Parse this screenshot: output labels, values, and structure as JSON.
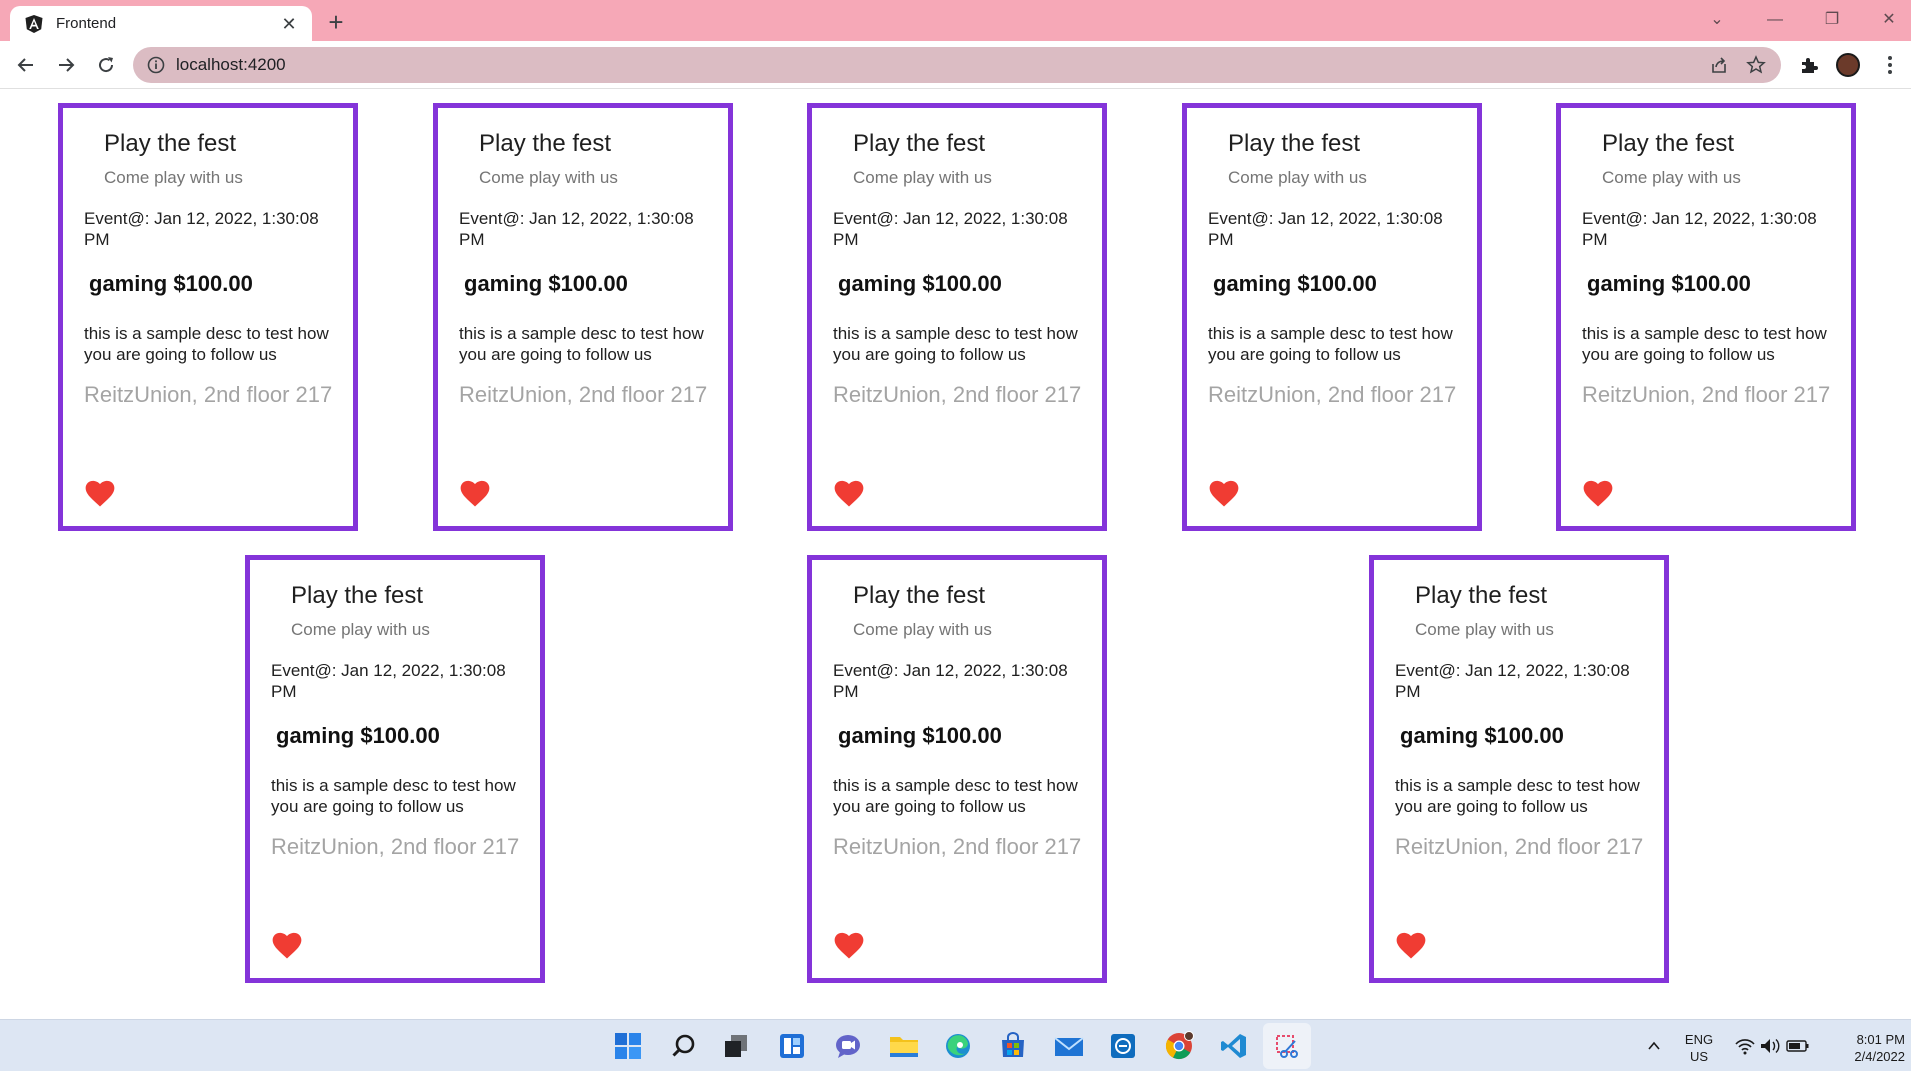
{
  "browser": {
    "tab_title": "Frontend",
    "tab_close": "✕",
    "new_tab": "+",
    "url": "localhost:4200",
    "window_controls": {
      "dropdown": "⌄",
      "minimize": "—",
      "restore": "❐",
      "close": "✕"
    }
  },
  "colors": {
    "tabbar": "#f6a8b7",
    "omnibox": "#dbbcc3",
    "card_border": "#8434d9",
    "heart": "#f03c33",
    "taskbar": "#dde6f3"
  },
  "cards": [
    {
      "title": "Play the fest",
      "subtitle": "Come play with us",
      "date": "Event@: Jan 12, 2022, 1:30:08 PM",
      "price": "gaming $100.00",
      "description": "this is a sample desc to test how you are going to follow us",
      "location": "ReitzUnion, 2nd floor 217"
    },
    {
      "title": "Play the fest",
      "subtitle": "Come play with us",
      "date": "Event@: Jan 12, 2022, 1:30:08 PM",
      "price": "gaming $100.00",
      "description": "this is a sample desc to test how you are going to follow us",
      "location": "ReitzUnion, 2nd floor 217"
    },
    {
      "title": "Play the fest",
      "subtitle": "Come play with us",
      "date": "Event@: Jan 12, 2022, 1:30:08 PM",
      "price": "gaming $100.00",
      "description": "this is a sample desc to test how you are going to follow us",
      "location": "ReitzUnion, 2nd floor 217"
    },
    {
      "title": "Play the fest",
      "subtitle": "Come play with us",
      "date": "Event@: Jan 12, 2022, 1:30:08 PM",
      "price": "gaming $100.00",
      "description": "this is a sample desc to test how you are going to follow us",
      "location": "ReitzUnion, 2nd floor 217"
    },
    {
      "title": "Play the fest",
      "subtitle": "Come play with us",
      "date": "Event@: Jan 12, 2022, 1:30:08 PM",
      "price": "gaming $100.00",
      "description": "this is a sample desc to test how you are going to follow us",
      "location": "ReitzUnion, 2nd floor 217"
    },
    {
      "title": "Play the fest",
      "subtitle": "Come play with us",
      "date": "Event@: Jan 12, 2022, 1:30:08 PM",
      "price": "gaming $100.00",
      "description": "this is a sample desc to test how you are going to follow us",
      "location": "ReitzUnion, 2nd floor 217"
    },
    {
      "title": "Play the fest",
      "subtitle": "Come play with us",
      "date": "Event@: Jan 12, 2022, 1:30:08 PM",
      "price": "gaming $100.00",
      "description": "this is a sample desc to test how you are going to follow us",
      "location": "ReitzUnion, 2nd floor 217"
    },
    {
      "title": "Play the fest",
      "subtitle": "Come play with us",
      "date": "Event@: Jan 12, 2022, 1:30:08 PM",
      "price": "gaming $100.00",
      "description": "this is a sample desc to test how you are going to follow us",
      "location": "ReitzUnion, 2nd floor 217"
    }
  ],
  "taskbar": {
    "apps": [
      "windows-start",
      "search",
      "task-view",
      "widgets",
      "chat",
      "file-explorer",
      "edge",
      "store",
      "mail",
      "app-circle",
      "chrome",
      "vscode",
      "snipping-tool"
    ],
    "language": "ENG",
    "region": "US",
    "time": "8:01 PM",
    "date": "2/4/2022"
  }
}
